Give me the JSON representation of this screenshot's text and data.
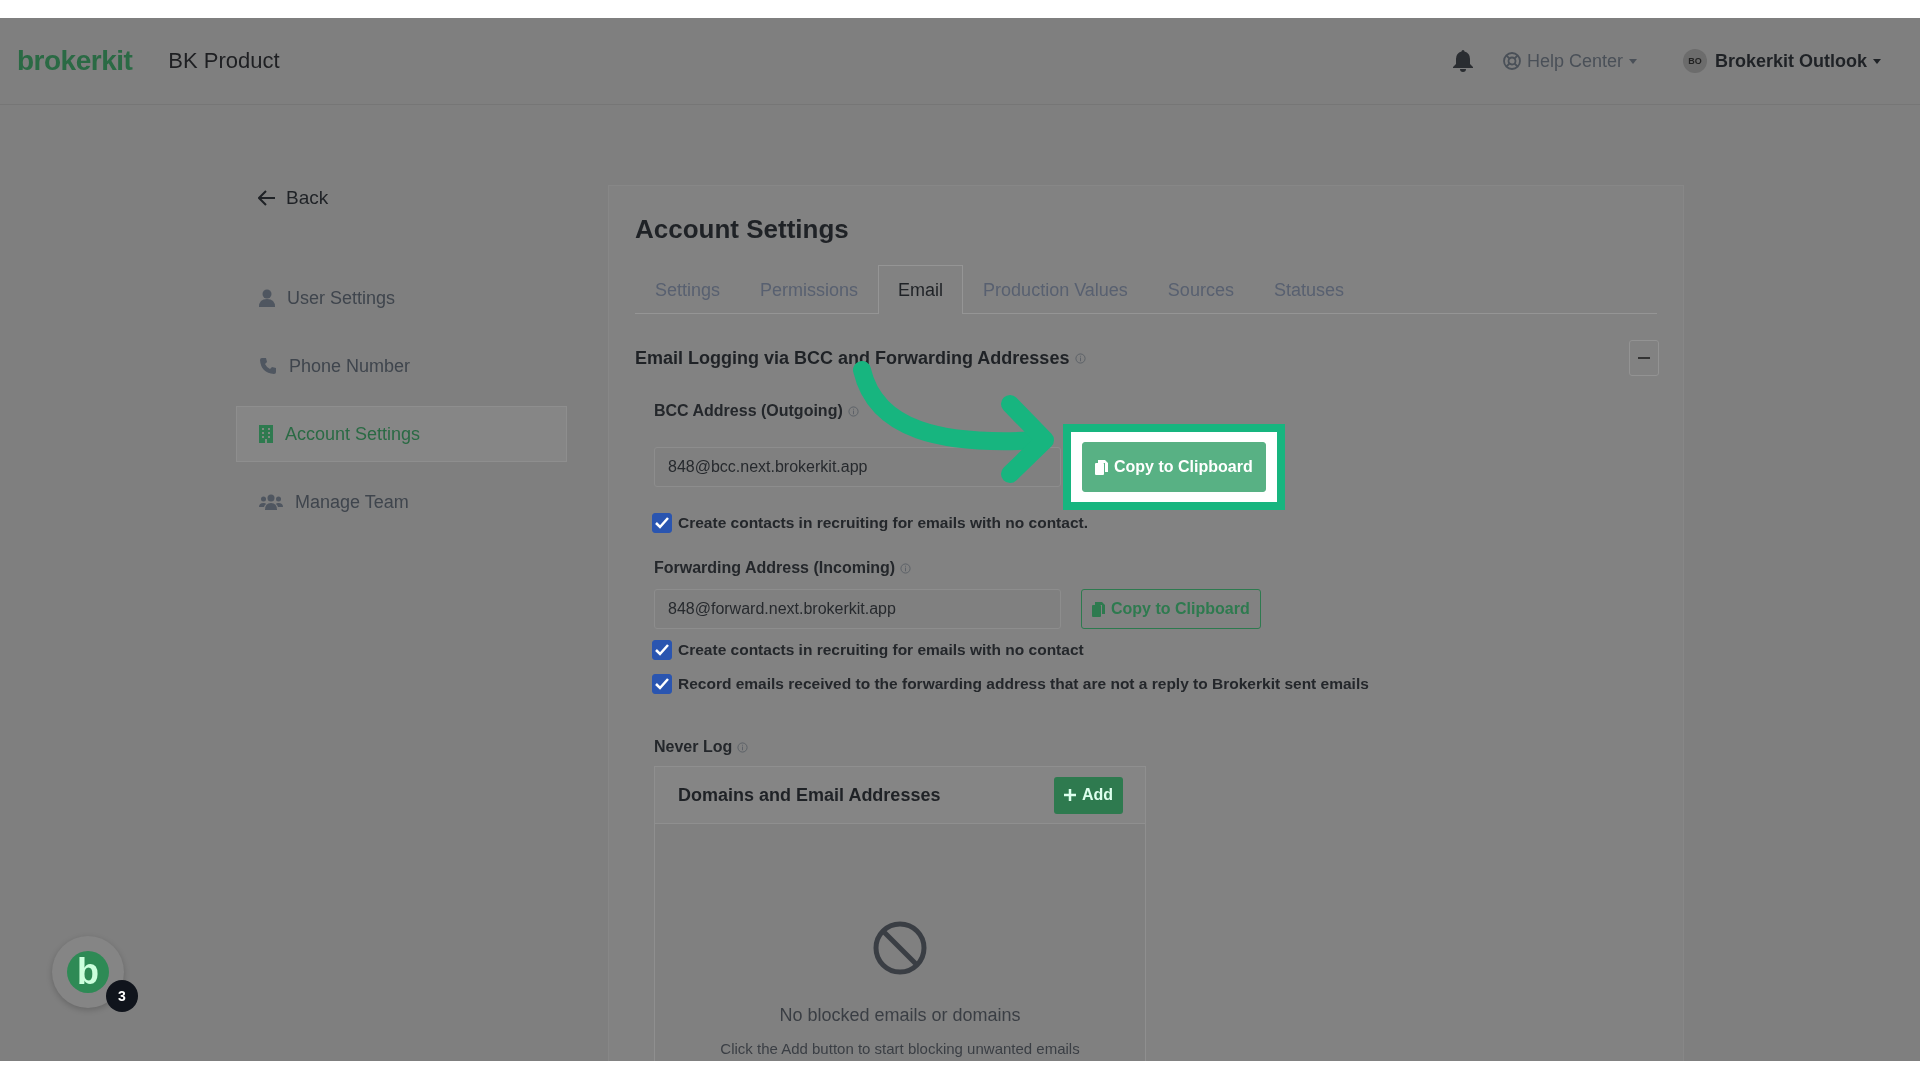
{
  "header": {
    "logo": "brokerkit",
    "product": "BK Product",
    "help": "Help Center",
    "user_initials": "BO",
    "user_name": "Brokerkit Outlook"
  },
  "back": "Back",
  "sidebar": {
    "items": [
      {
        "label": "User Settings",
        "selected": false
      },
      {
        "label": "Phone Number",
        "selected": false
      },
      {
        "label": "Account Settings",
        "selected": true
      },
      {
        "label": "Manage Team",
        "selected": false
      }
    ]
  },
  "page": {
    "title": "Account Settings",
    "tabs": [
      {
        "label": "Settings",
        "selected": false
      },
      {
        "label": "Permissions",
        "selected": false
      },
      {
        "label": "Email",
        "selected": true
      },
      {
        "label": "Production Values",
        "selected": false
      },
      {
        "label": "Sources",
        "selected": false
      },
      {
        "label": "Statuses",
        "selected": false
      }
    ]
  },
  "section": {
    "title": "Email Logging via BCC and Forwarding Addresses",
    "addresses": [
      {
        "label": "BCC Address (Outgoing)",
        "value": "848@bcc.next.brokerkit.app",
        "button": "Copy to Clipboard",
        "highlighted": true,
        "checkboxes": [
          {
            "label": "Create contacts in recruiting for emails with no contact.",
            "checked": true
          }
        ]
      },
      {
        "label": "Forwarding Address (Incoming)",
        "value": "848@forward.next.brokerkit.app",
        "button": "Copy to Clipboard",
        "highlighted": false,
        "checkboxes": [
          {
            "label": "Create contacts in recruiting for emails with no contact",
            "checked": true
          },
          {
            "label": "Record emails received to the forwarding address that are not a reply to Brokerkit sent emails",
            "checked": true
          }
        ]
      }
    ],
    "never_log": {
      "label": "Never Log",
      "table_title": "Domains and Email Addresses",
      "add_button": "Add",
      "empty_title": "No blocked emails or domains",
      "empty_text": "Click the Add button to start blocking unwanted emails"
    }
  },
  "launcher": {
    "letter": "b",
    "badge": "3"
  }
}
